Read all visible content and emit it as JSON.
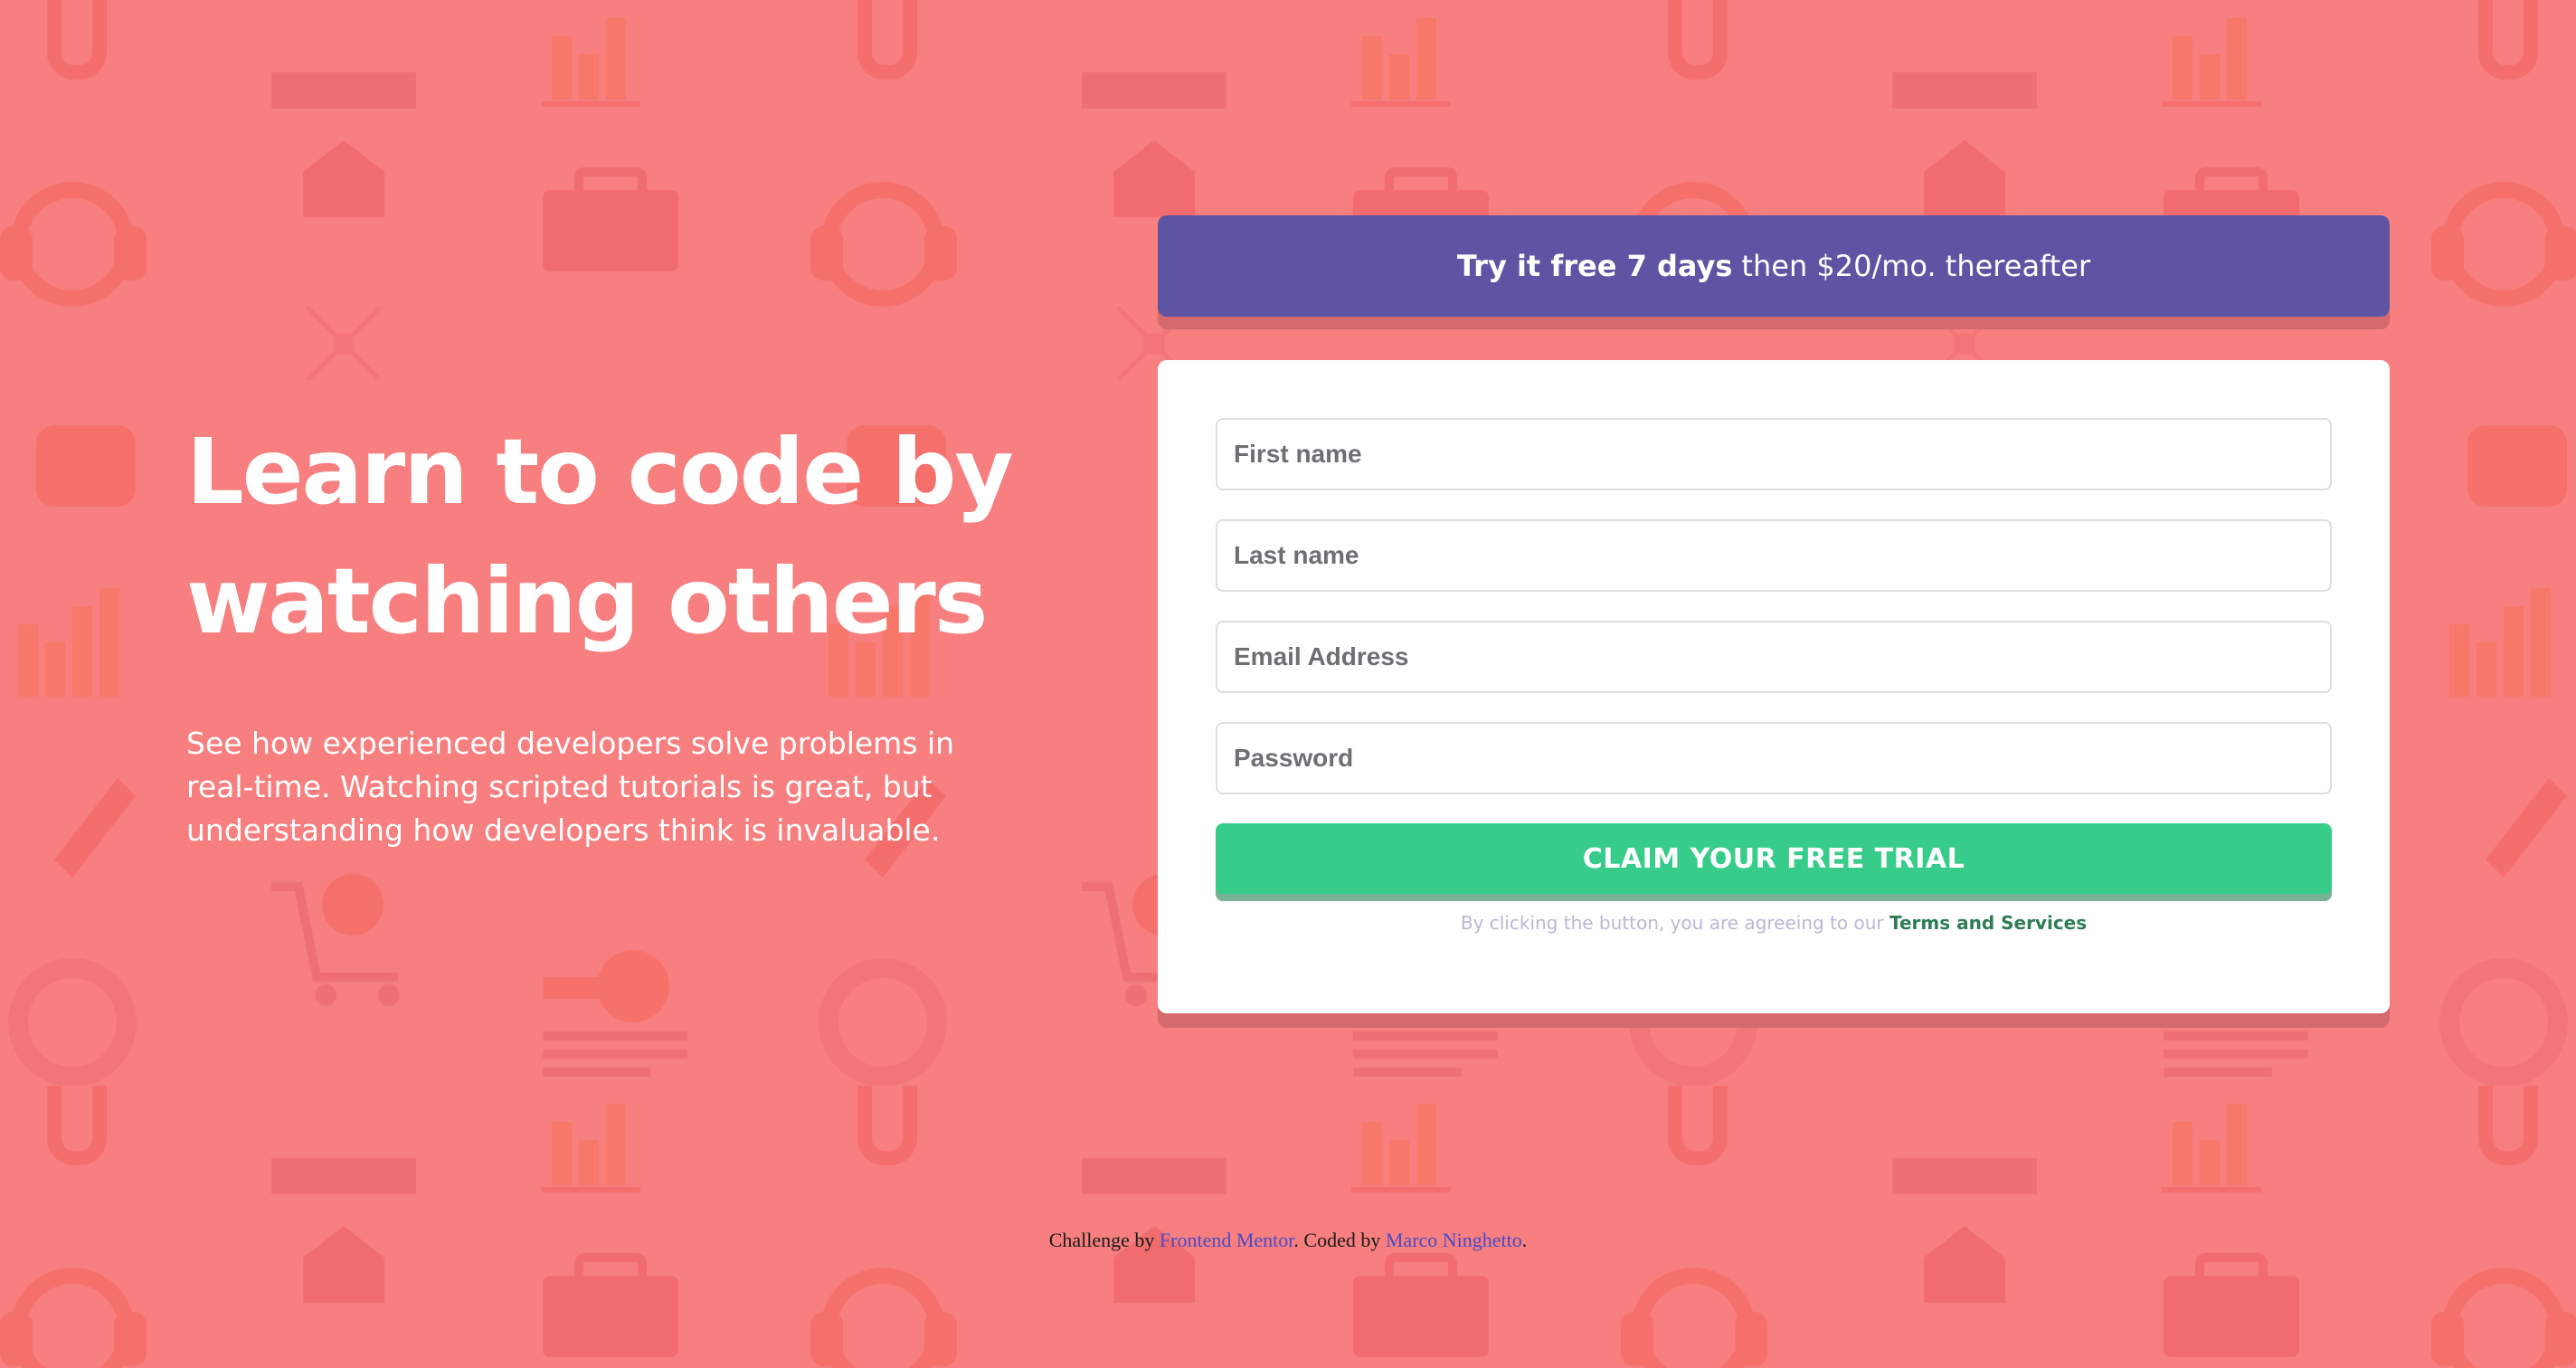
{
  "hero": {
    "title": "Learn to code by watching others",
    "text": "See how experienced developers solve problems in real-time. Watching scripted tutorials is great, but understanding how developers think is invaluable."
  },
  "promo": {
    "bold": "Try it free 7 days",
    "rest": "then $20/mo. thereafter"
  },
  "form": {
    "first_name_placeholder": "First name",
    "last_name_placeholder": "Last name",
    "email_placeholder": "Email Address",
    "password_placeholder": "Password",
    "submit_label": "CLAIM YOUR FREE TRIAL",
    "terms_prefix": "By clicking the button, you are agreeing to our",
    "terms_link": "Terms and Services"
  },
  "attribution": {
    "prefix": "Challenge by",
    "link1": "Frontend Mentor",
    "middle": ". Coded by",
    "link2": "Marco Ninghetto",
    "suffix": "."
  },
  "colors": {
    "background": "#f77f7f",
    "promo": "#5e54a4",
    "cta": "#38cc8b",
    "terms_link": "#2e7d54"
  },
  "background_icons": [
    "chart-icon",
    "house-icon",
    "headset-icon",
    "briefcase-icon",
    "key-icon",
    "rocket-icon",
    "gear-icon",
    "lifebuoy-icon",
    "calendar-icon",
    "cart-icon",
    "chain-icon",
    "lightbulb-icon"
  ]
}
